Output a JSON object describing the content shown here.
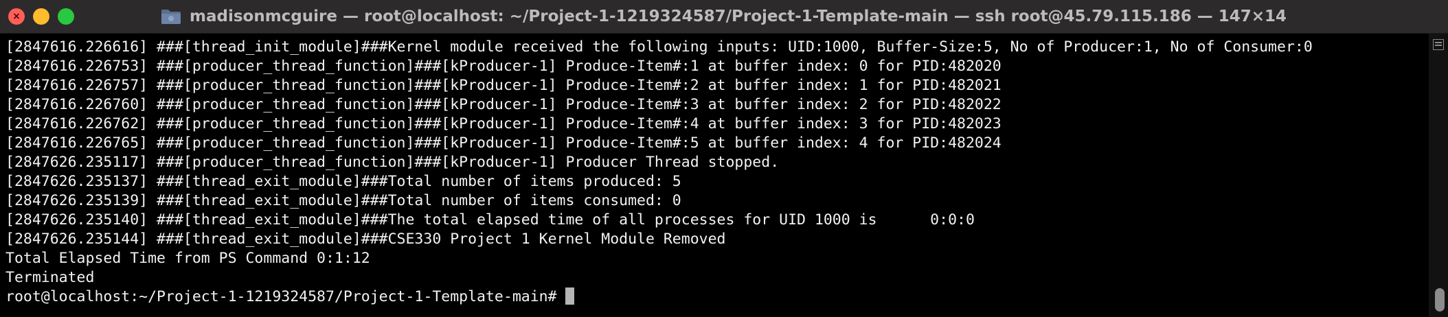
{
  "window": {
    "title": "madisonmcguire — root@localhost: ~/Project-1-1219324587/Project-1-Template-main — ssh root@45.79.115.186 — 147×14"
  },
  "colors": {
    "terminal_bg": "#000000",
    "terminal_fg": "#f2f2f2",
    "titlebar_bg": "#2d2a2c",
    "close": "#ff5f57",
    "minimize": "#febc2e",
    "maximize": "#28c840"
  },
  "icons": {
    "close": "close-icon",
    "close_glyph": "×",
    "minimize": "minimize-icon",
    "maximize": "maximize-icon",
    "folder": "folder-icon",
    "scroll_marks": "scroll-marks-icon"
  },
  "terminal": {
    "lines": [
      "[2847616.226616] ###[thread_init_module]###Kernel module received the following inputs: UID:1000, Buffer-Size:5, No of Producer:1, No of Consumer:0",
      "[2847616.226753] ###[producer_thread_function]###[kProducer-1] Produce-Item#:1 at buffer index: 0 for PID:482020",
      "[2847616.226757] ###[producer_thread_function]###[kProducer-1] Produce-Item#:2 at buffer index: 1 for PID:482021",
      "[2847616.226760] ###[producer_thread_function]###[kProducer-1] Produce-Item#:3 at buffer index: 2 for PID:482022",
      "[2847616.226762] ###[producer_thread_function]###[kProducer-1] Produce-Item#:4 at buffer index: 3 for PID:482023",
      "[2847616.226765] ###[producer_thread_function]###[kProducer-1] Produce-Item#:5 at buffer index: 4 for PID:482024",
      "[2847626.235117] ###[producer_thread_function]###[kProducer-1] Producer Thread stopped.",
      "[2847626.235137] ###[thread_exit_module]###Total number of items produced: 5",
      "[2847626.235139] ###[thread_exit_module]###Total number of items consumed: 0",
      "[2847626.235140] ###[thread_exit_module]###The total elapsed time of all processes for UID 1000 is      0:0:0",
      "[2847626.235144] ###[thread_exit_module]###CSE330 Project 1 Kernel Module Removed",
      "Total Elapsed Time from PS Command 0:1:12",
      "Terminated"
    ],
    "prompt": "root@localhost:~/Project-1-1219324587/Project-1-Template-main# "
  }
}
